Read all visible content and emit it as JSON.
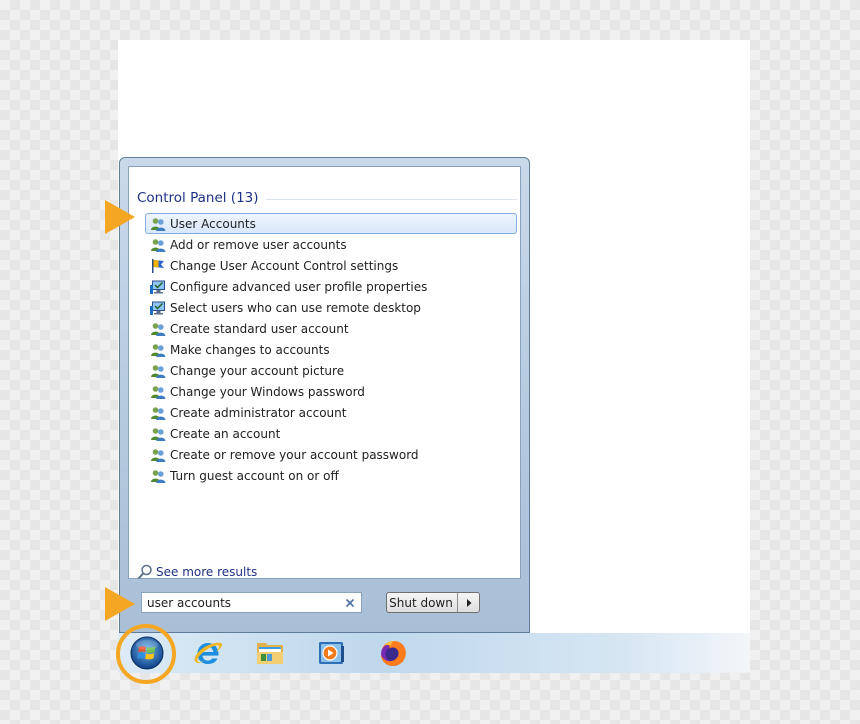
{
  "start_menu": {
    "group_title": "Control Panel (13)",
    "items": [
      {
        "label": "User Accounts",
        "icon": "users-icon",
        "selected": true
      },
      {
        "label": "Add or remove user accounts",
        "icon": "users-icon"
      },
      {
        "label": "Change User Account Control settings",
        "icon": "uac-flag-icon"
      },
      {
        "label": "Configure advanced user profile properties",
        "icon": "computer-icon"
      },
      {
        "label": "Select users who can use remote desktop",
        "icon": "computer-icon"
      },
      {
        "label": "Create standard user account",
        "icon": "users-icon"
      },
      {
        "label": "Make changes to accounts",
        "icon": "users-icon"
      },
      {
        "label": "Change your account picture",
        "icon": "users-icon"
      },
      {
        "label": "Change your Windows password",
        "icon": "users-icon"
      },
      {
        "label": "Create administrator account",
        "icon": "users-icon"
      },
      {
        "label": "Create an account",
        "icon": "users-icon"
      },
      {
        "label": "Create or remove your account password",
        "icon": "users-icon"
      },
      {
        "label": "Turn guest account on or off",
        "icon": "users-icon"
      }
    ],
    "see_more": "See more results",
    "search_value": "user accounts",
    "shutdown_label": "Shut down"
  },
  "taskbar": {
    "icons": [
      "windows-start-orb-icon",
      "internet-explorer-icon",
      "file-explorer-icon",
      "media-player-icon",
      "firefox-icon"
    ]
  },
  "colors": {
    "accent_highlight": "#f5a623",
    "group_title": "#1e3287",
    "selection_border": "#84acdd"
  }
}
